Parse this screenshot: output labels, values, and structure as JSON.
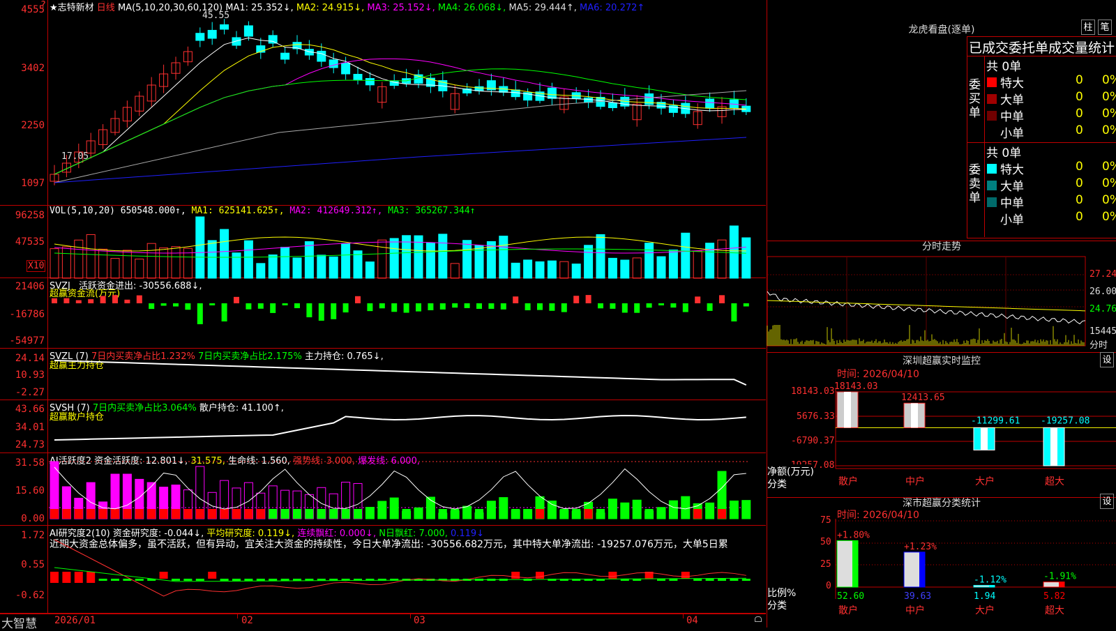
{
  "stock": {
    "title": "★志特新材",
    "period": "日线",
    "ma_label": "MA(5,10,20,30,60,120)",
    "ma1": "MA1: 25.352↓,",
    "ma2": "MA2: 24.915↓,",
    "ma3": "MA3: 25.152↓,",
    "ma4": "MA4: 26.068↓,",
    "ma5": "MA5: 29.444↑,",
    "ma6": "MA6: 20.272↑",
    "high_mark": "45.55",
    "low_mark": "17.05",
    "y_labels": [
      "4555",
      "3402",
      "2250",
      "1097"
    ],
    "top_marker": "?"
  },
  "vol": {
    "label": "VOL(5,10,20)",
    "value": "650548.000↑,",
    "ma1": "MA1: 625141.625↑,",
    "ma2": "MA2: 412649.312↑,",
    "ma3": "MA3: 365267.344↑",
    "y_labels": [
      "96258",
      "47535"
    ],
    "unit": "X10"
  },
  "svzj": {
    "label": "SVZJ",
    "value": "活跃资金进出: -30556.688↓,",
    "sub": "超赢资金流(万元)",
    "y_labels": [
      "21406",
      "-16786",
      "-54977"
    ]
  },
  "svzl": {
    "label": "SVZL (7)",
    "v1": "7日内买卖净占比1.232%",
    "v2": "7日内买卖净占比2.175%",
    "v3": "主力持仓: 0.765↓,",
    "sub": "超赢主力持仓",
    "y_labels": [
      "24.14",
      "10.93",
      "-2.27"
    ]
  },
  "svsh": {
    "label": "SVSH (7)",
    "v1": "7日内买卖净占比3.064%",
    "v2": "散户持仓: 41.100↑,",
    "sub": "超赢散户持仓",
    "y_labels": [
      "43.66",
      "34.01",
      "24.73"
    ]
  },
  "ai1": {
    "label": "AI活跃度2",
    "v1": "资金活跃度: 12.801↓,",
    "v2": "31.575,",
    "v3": "生命线: 1.560,",
    "v4": "强势线: 3.000,",
    "v5": "爆发线: 6.000,",
    "y_labels": [
      "31.58",
      "15.60",
      "0.00"
    ]
  },
  "ai2": {
    "label": "AI研究度2(10)",
    "v1": "资金研究度: -0.044↓,",
    "v2": "平均研究度: 0.119↓,",
    "v3": "连续飘红: 0.000↓,",
    "v4": "N日飘红: 7.000,",
    "v5": "0.119↓",
    "comment": "近期大资金总体偏多，虽不活跃，但有异动，宜关注大资金的持续性，今日大单净流出: -30556.682万元，其中特大单净流出: -19257.076万元，大单5日累",
    "y_labels": [
      "1.72",
      "0.55",
      "-0.62"
    ]
  },
  "xaxis": {
    "app_name": "大智慧",
    "labels": [
      "2026/01",
      "02",
      "03",
      "04"
    ]
  },
  "longhu": {
    "title": "龙虎看盘(逐单)",
    "btn1": "柱",
    "btn2": "笔",
    "stats_title": "已成交委托单成交量统计",
    "buy_label": "委买单",
    "sell_label": "委卖单",
    "buy_total": "共 0单",
    "sell_total": "共 0单",
    "buy_rows": [
      {
        "name": "特大",
        "n": "0",
        "p": "0%",
        "color": "#ff0000"
      },
      {
        "name": "大单",
        "n": "0",
        "p": "0%",
        "color": "#a00000"
      },
      {
        "name": "中单",
        "n": "0",
        "p": "0%",
        "color": "#700000"
      },
      {
        "name": "小单",
        "n": "0",
        "p": "0%",
        "color": ""
      }
    ],
    "sell_rows": [
      {
        "name": "特大",
        "n": "0",
        "p": "0%",
        "color": "#00ffff"
      },
      {
        "name": "大单",
        "n": "0",
        "p": "0%",
        "color": "#008080"
      },
      {
        "name": "中单",
        "n": "0",
        "p": "0%",
        "color": "#006a6a"
      },
      {
        "name": "小单",
        "n": "0",
        "p": "0%",
        "color": ""
      }
    ]
  },
  "intraday": {
    "title": "分时走势",
    "y_labels": [
      "27.24",
      "26.00",
      "24.76"
    ],
    "vol_label": "15445",
    "footer": "分时"
  },
  "sz_monitor": {
    "title": "深圳超赢实时监控",
    "date": "时间: 2026/04/10",
    "btn": "设",
    "y_labels": [
      "18143.03",
      "5676.33",
      "-6790.37",
      "-19257.08"
    ],
    "ylabel": "净额(万元)",
    "xlabel": "分类",
    "categories": [
      "散户",
      "中户",
      "大户",
      "超大"
    ],
    "values": [
      18143.03,
      12413.65,
      -11299.61,
      -19257.08
    ],
    "value_labels": [
      "18143.03",
      "12413.65",
      "-11299.61",
      "-19257.08"
    ]
  },
  "sz_class": {
    "title": "深市超赢分类统计",
    "date": "时间: 2026/04/10",
    "btn": "设",
    "y_labels": [
      "75",
      "50",
      "25",
      "0"
    ],
    "ylabel": "比例%",
    "xlabel": "分类",
    "categories": [
      "散户",
      "中户",
      "大户",
      "超大"
    ],
    "ratios": [
      52.6,
      39.63,
      1.94,
      5.82
    ],
    "ratio_labels": [
      "52.60",
      "39.63",
      "1.94",
      "5.82"
    ],
    "changes": [
      "+1.80%",
      "+1.23%",
      "-1.12%",
      "-1.91%"
    ],
    "colors": [
      "#00ff00",
      "#0000ff",
      "#00ffff",
      "#ff0000"
    ]
  }
}
